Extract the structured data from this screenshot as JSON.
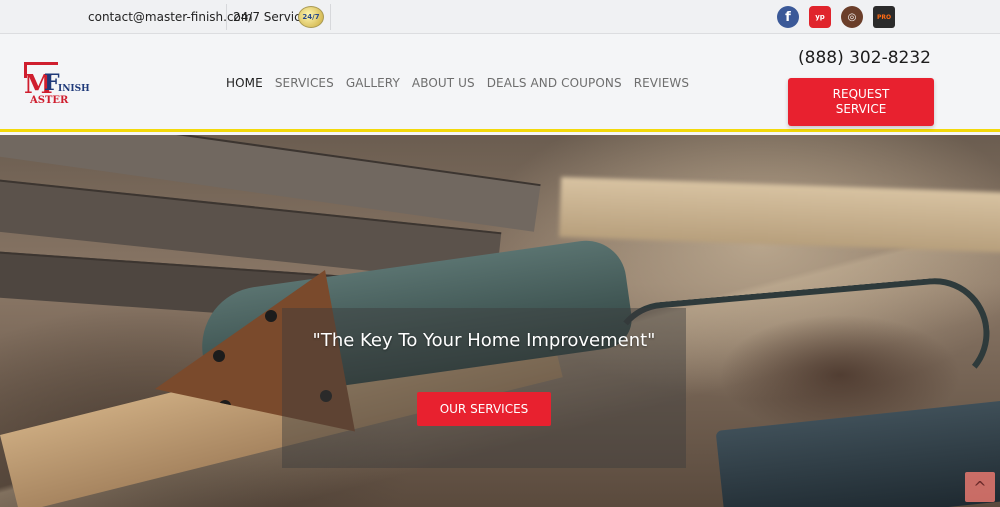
{
  "topbar": {
    "email": "contact@master-finish.com",
    "service": "24/7 Service",
    "badge": "24/7",
    "social": [
      {
        "name": "facebook-icon",
        "glyph": "f"
      },
      {
        "name": "yellow-pages-icon",
        "glyph": "yp"
      },
      {
        "name": "instagram-icon",
        "glyph": "◎"
      },
      {
        "name": "home-depot-pro-icon",
        "glyph": "PRO"
      }
    ]
  },
  "header": {
    "logo": {
      "m": "M",
      "f": "F",
      "finish": "INISH",
      "aster": "ASTER"
    },
    "nav": [
      {
        "label": "HOME",
        "active": true
      },
      {
        "label": "SERVICES",
        "active": false
      },
      {
        "label": "GALLERY",
        "active": false
      },
      {
        "label": "ABOUT US",
        "active": false
      },
      {
        "label": "DEALS AND COUPONS",
        "active": false
      },
      {
        "label": "REVIEWS",
        "active": false
      }
    ],
    "phone": "(888) 302-8232",
    "request_button": {
      "line1": "REQUEST",
      "line2": "SERVICE"
    }
  },
  "hero": {
    "title": "\"The Key To Your Home Improvement\"",
    "button": "OUR SERVICES",
    "back_to_top": "^"
  },
  "colors": {
    "accent": "#e8212f",
    "underline": "#f2d90a",
    "brand_blue": "#1f3a7a",
    "brand_red": "#cf1e2e"
  }
}
